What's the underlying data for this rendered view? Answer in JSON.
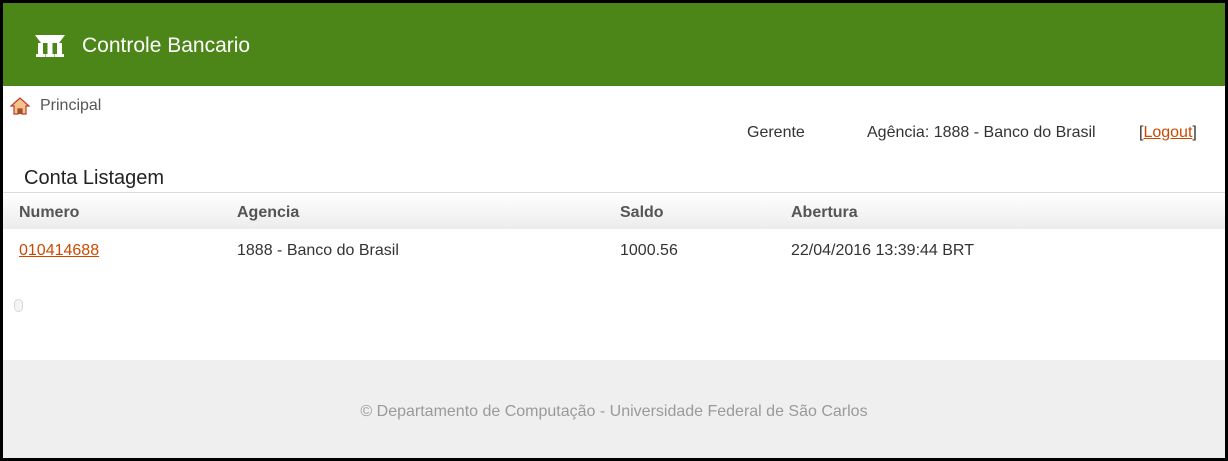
{
  "header": {
    "title": "Controle Bancario",
    "logo_icon": "bank-logo-icon",
    "background": "#4c8618"
  },
  "nav": {
    "home_label": "Principal",
    "home_icon": "home-icon"
  },
  "user": {
    "role": "Gerente",
    "agency": "Agência: 1888 - Banco do Brasil",
    "logout_open": "[",
    "logout_label": "Logout",
    "logout_close": "]"
  },
  "section": {
    "title": "Conta Listagem"
  },
  "table": {
    "columns": [
      "Numero",
      "Agencia",
      "Saldo",
      "Abertura"
    ],
    "rows": [
      [
        "010414688",
        "1888 - Banco do Brasil",
        "1000.56",
        "22/04/2016 13:39:44 BRT"
      ]
    ]
  },
  "footer": {
    "text": "© Departamento de Computação - Universidade Federal de São Carlos"
  },
  "colors": {
    "link": "#cc4a00",
    "footer_bg": "#efefef"
  }
}
